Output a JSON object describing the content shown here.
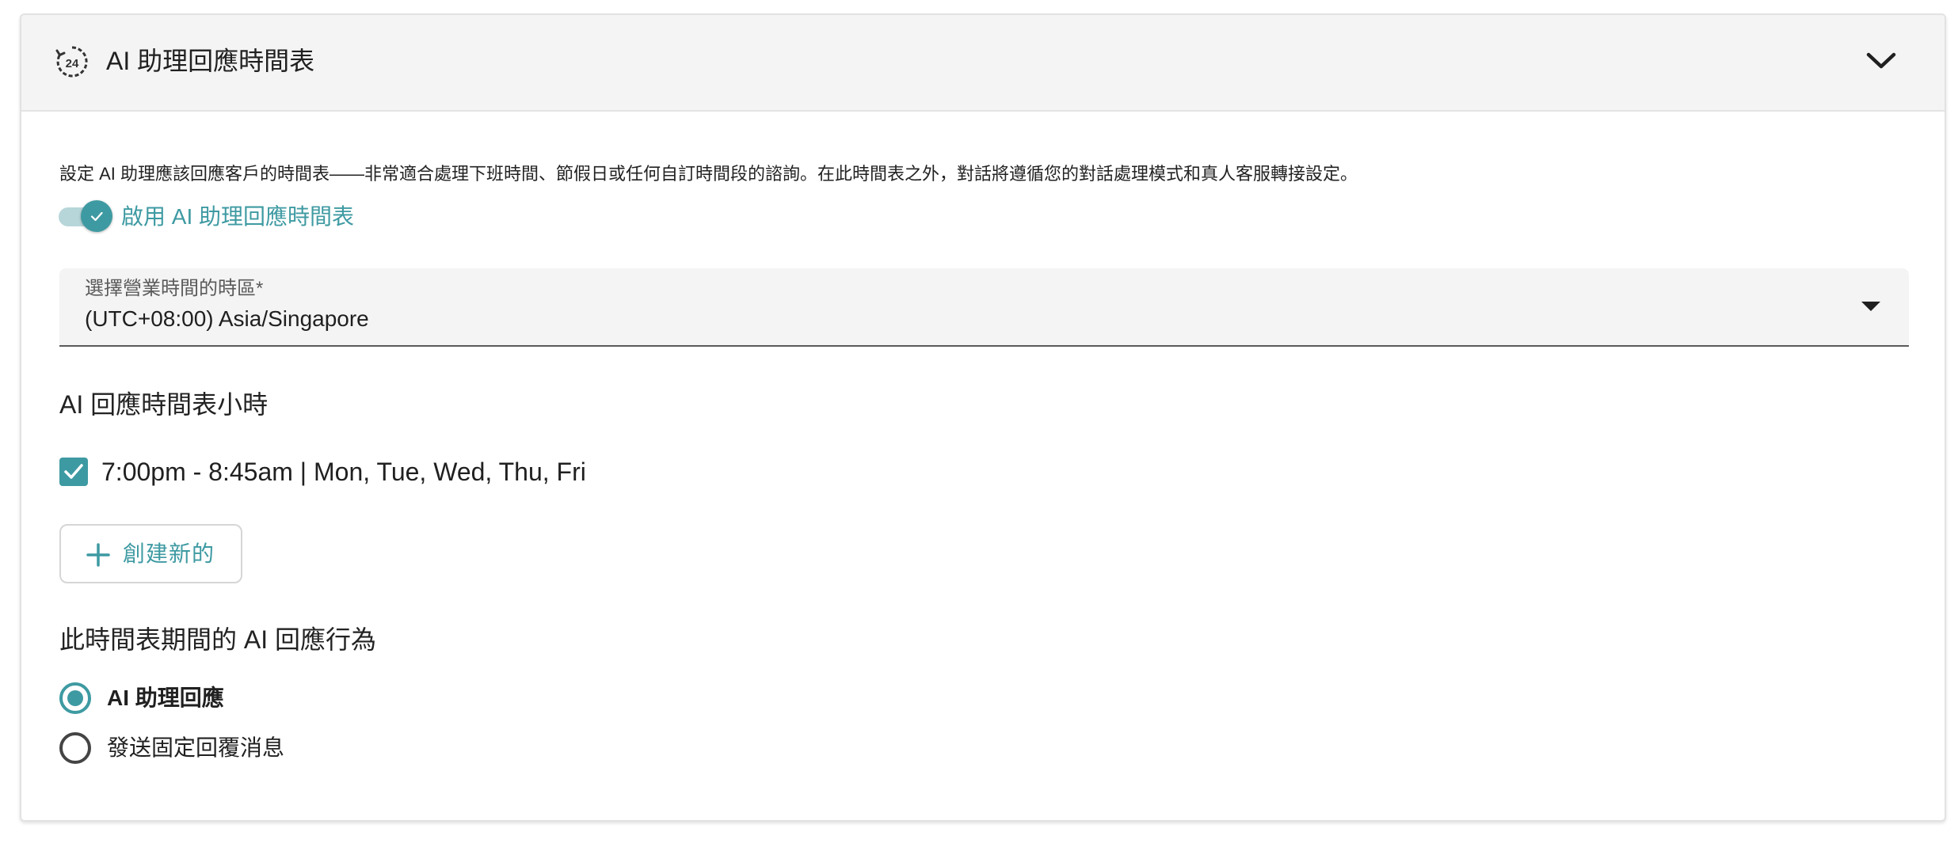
{
  "panel": {
    "title": "AI 助理回應時間表",
    "header_icon": "24-hour-clock-icon",
    "collapse_icon": "chevron-down-icon"
  },
  "description": "設定 AI 助理應該回應客戶的時間表——非常適合處理下班時間、節假日或任何自訂時間段的諮詢。在此時間表之外，對話將遵循您的對話處理模式和真人客服轉接設定。",
  "toggle": {
    "label": "啟用 AI 助理回應時間表",
    "enabled": true
  },
  "timezone": {
    "label": "選擇營業時間的時區",
    "required_marker": "*",
    "value": "(UTC+08:00) Asia/Singapore"
  },
  "schedule_section": {
    "title": "AI 回應時間表小時",
    "items": [
      {
        "text": "7:00pm - 8:45am | Mon, Tue, Wed, Thu, Fri",
        "checked": true
      }
    ],
    "create_button_label": "創建新的"
  },
  "behavior_section": {
    "title": "此時間表期間的 AI 回應行為",
    "options": [
      {
        "label": "AI 助理回應",
        "selected": true
      },
      {
        "label": "發送固定回覆消息",
        "selected": false
      }
    ]
  },
  "colors": {
    "accent": "#3e9aa2",
    "header_bg": "#f4f4f4",
    "field_bg": "#f4f4f4"
  }
}
